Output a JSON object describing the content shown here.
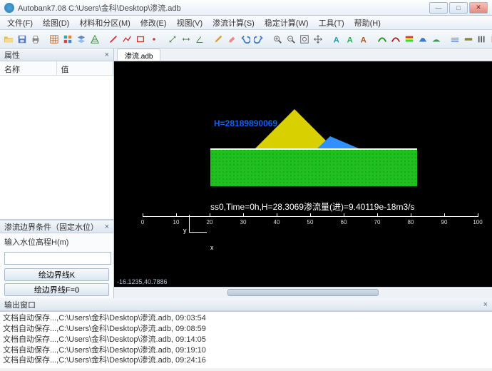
{
  "title": "Autobank7.08 C:\\Users\\金科\\Desktop\\渗流.adb",
  "window_buttons": {
    "min": "—",
    "max": "□",
    "close": "✕"
  },
  "menu": [
    "文件(F)",
    "绘图(D)",
    "材料和分区(M)",
    "修改(E)",
    "视图(V)",
    "渗流计算(S)",
    "稳定计算(W)",
    "工具(T)",
    "帮助(H)"
  ],
  "panels": {
    "properties": {
      "title": "属性",
      "col_name": "名称",
      "col_value": "值"
    },
    "boundary": {
      "title": "渗流边界条件（固定水位）",
      "input_label": "输入水位高程H(m)",
      "btn_k": "绘边界线K",
      "btn_f0": "绘边界线F=0"
    },
    "output": {
      "title": "输出窗口",
      "lines": [
        "文档自动保存...,C:\\Users\\金科\\Desktop\\渗流.adb, 09:03:54",
        "文档自动保存...,C:\\Users\\金科\\Desktop\\渗流.adb, 09:08:59",
        "文档自动保存...,C:\\Users\\金科\\Desktop\\渗流.adb, 09:14:05",
        "文档自动保存...,C:\\Users\\金科\\Desktop\\渗流.adb, 09:19:10",
        "文档自动保存...,C:\\Users\\金科\\Desktop\\渗流.adb, 09:24:16"
      ]
    }
  },
  "tab_label": "渗流.adb",
  "canvas": {
    "hlabel": "H=28189890069",
    "status": "ss0,Time=0h,H=28.3069渗流量(进)=9.40119e-18m3/s",
    "coords": "-16.1235,40.7886",
    "axis_y": "y",
    "axis_x": "x",
    "ruler_ticks": [
      "0",
      "10",
      "20",
      "30",
      "40",
      "50",
      "60",
      "70",
      "80",
      "90",
      "100"
    ]
  }
}
